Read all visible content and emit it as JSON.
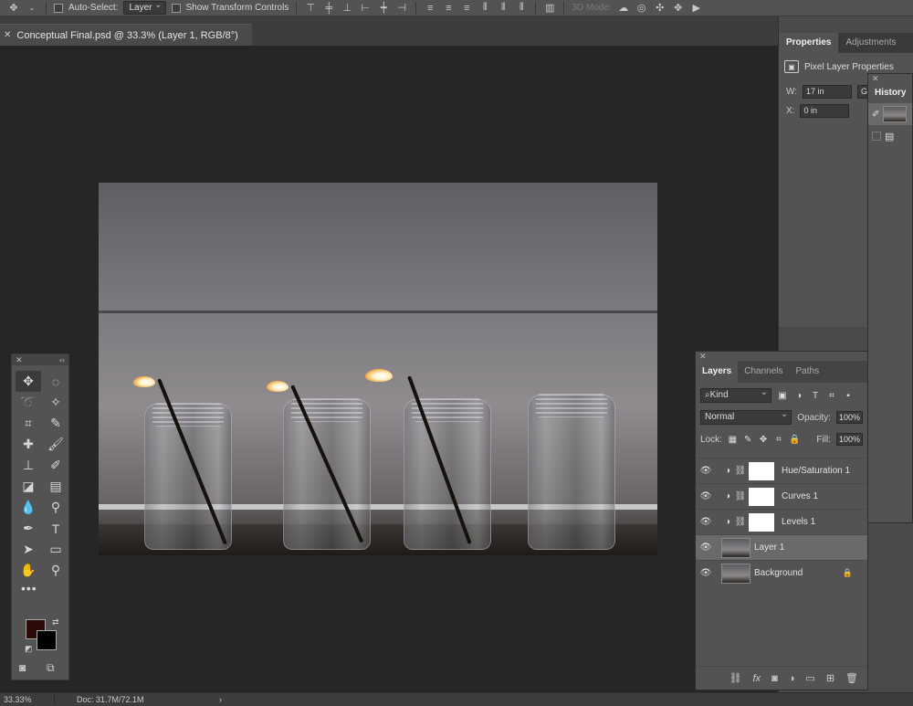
{
  "options_bar": {
    "auto_select_label": "Auto-Select:",
    "auto_select_value": "Layer",
    "show_transform_label": "Show Transform Controls",
    "mode_3d_label": "3D Mode:"
  },
  "document": {
    "tab_title": "Conceptual Final.psd @ 33.3% (Layer 1, RGB/8°)"
  },
  "tools": [
    "move-tool",
    "marquee-tool",
    "lasso-tool",
    "magic-wand-tool",
    "crop-tool",
    "eyedropper-tool",
    "healing-brush-tool",
    "brush-tool",
    "clone-stamp-tool",
    "history-brush-tool",
    "eraser-tool",
    "gradient-tool",
    "blur-tool",
    "dodge-tool",
    "pen-tool",
    "type-tool",
    "path-selection-tool",
    "rectangle-tool",
    "hand-tool",
    "zoom-tool"
  ],
  "colors": {
    "foreground": "#2b0a08",
    "background": "#000000"
  },
  "properties": {
    "tabs": [
      "Properties",
      "Adjustments"
    ],
    "header": "Pixel Layer Properties",
    "w_label": "W:",
    "w_value": "17 in",
    "x_label": "X:",
    "x_value": "0 in",
    "extra": "G"
  },
  "history": {
    "title": "History"
  },
  "layers": {
    "tabs": [
      "Layers",
      "Channels",
      "Paths"
    ],
    "kind_label": "Kind",
    "blend_mode": "Normal",
    "opacity_label": "Opacity:",
    "opacity_value": "100%",
    "lock_label": "Lock:",
    "fill_label": "Fill:",
    "fill_value": "100%",
    "items": [
      {
        "name": "Hue/Saturation 1",
        "type": "adjustment",
        "selected": false
      },
      {
        "name": "Curves 1",
        "type": "adjustment",
        "selected": false
      },
      {
        "name": "Levels 1",
        "type": "adjustment",
        "selected": false
      },
      {
        "name": "Layer 1",
        "type": "pixel",
        "selected": true
      },
      {
        "name": "Background",
        "type": "pixel",
        "selected": false,
        "locked": true
      }
    ]
  },
  "status": {
    "zoom": "33.33%",
    "doc": "Doc: 31.7M/72.1M"
  }
}
